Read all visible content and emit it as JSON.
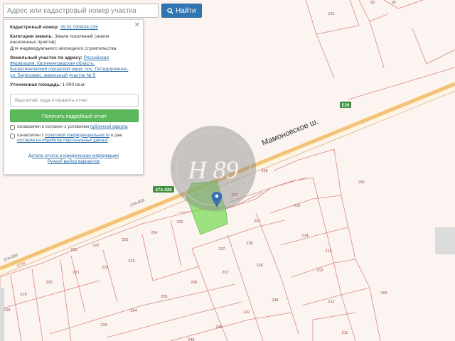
{
  "search": {
    "placeholder": "Адрес или кадастровый номер участка",
    "button_label": "Найти"
  },
  "panel": {
    "cadastral_label": "Кадастровый номер:",
    "cadastral_value": "39:01:030804:226",
    "category_label": "Категория земель:",
    "category_value_1": "Земли поселений (земли",
    "category_value_2": "населенных пунктов)",
    "category_use": "Для индивидуального жилищного строительства",
    "address_label": "Земельный участок по адресу:",
    "address_1": "Российская",
    "address_2": "Федерация, Калининградская область,",
    "address_3": "Багратионовский городской округ, пос. Пятидорожное,",
    "address_4": "ул. Берёзовая, земельный участок № 5",
    "area_label": "Уточненная площадь:",
    "area_value": "1 000 кв.м.",
    "email_placeholder": "Ваш email, куда отправить отчет",
    "report_button": "Получить подробный отчет",
    "consent1_text": "ознакомлен и согласен с условиями",
    "consent1_link": "публичной оферты",
    "consent2_text": "ознакомлен с",
    "consent2_link_a": "политикой конфиденциальности",
    "consent2_text2": "и даю",
    "consent2_link_b": "согласие на обработку персональных данных",
    "details_link": "Детали отчета и юридическая информация",
    "manual_link": "Ручной выбор вариантов"
  },
  "map": {
    "road_name": "Мамоновское ш.",
    "road_badge_e28": "E28",
    "road_badge_27a": "27А-020",
    "road_code": "27А-020",
    "road_code_2": "27А-020",
    "watermark": "Н 89",
    "selected_color": "#7ddc5b",
    "marker_color": "#3a6fb6",
    "badge_color": "#3c8f3c",
    "parcels": [
      "101",
      "90",
      "92",
      "169",
      "227",
      "228",
      "225",
      "224",
      "223",
      "222",
      "221",
      "221",
      "222",
      "223",
      "220",
      "219",
      "218",
      "237",
      "237",
      "238",
      "238",
      "236",
      "235",
      "234",
      "233",
      "247",
      "248",
      "246",
      "245",
      "215",
      "214",
      "213",
      "213",
      "212",
      "211",
      "169",
      "267",
      "1778"
    ]
  }
}
